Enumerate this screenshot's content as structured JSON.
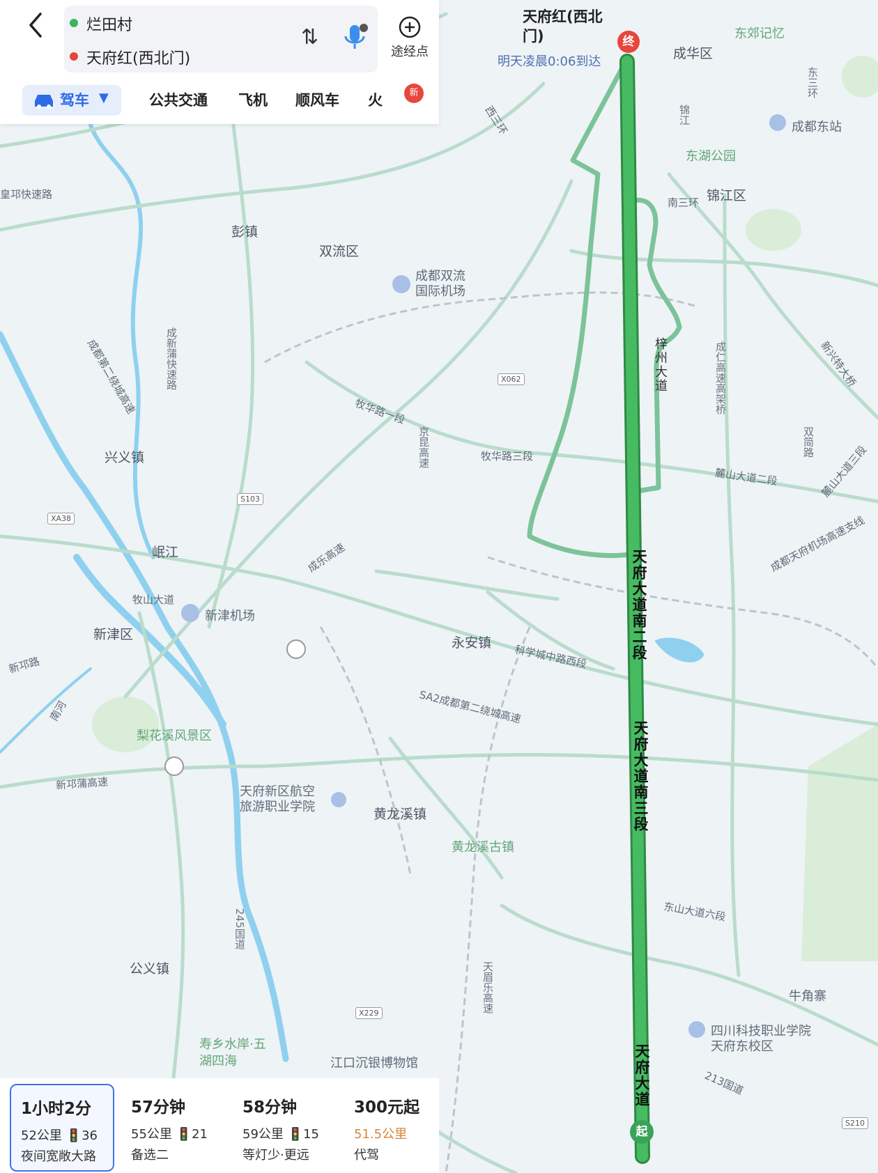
{
  "header": {
    "origin": "烂田村",
    "destination": "天府红(西北门)",
    "via_label": "途经点"
  },
  "mode_tabs": [
    "驾车",
    "公共交通",
    "飞机",
    "顺风车",
    "火"
  ],
  "new_badge": "新",
  "map": {
    "dest_label": "天府红(西北门)",
    "arrival_text": "明天凌晨0:06到达",
    "end_marker": "终",
    "start_marker": "起",
    "place_labels": [
      "成华区",
      "锦江区",
      "双流区",
      "彭镇",
      "兴义镇",
      "新津区",
      "永安镇",
      "黄龙溪镇",
      "公义镇",
      "牛角寨"
    ],
    "poi_labels": [
      "东郊记忆",
      "成都东站",
      "东湖公园",
      "成都双流国际机场",
      "新津机场",
      "梨花溪风景区",
      "天府新区航空旅游职业学院",
      "黄龙溪古镇",
      "寿乡水岸·五湖四海",
      "江口沉银博物馆",
      "四川科技职业学院天府东校区"
    ],
    "road_labels": [
      "西三环",
      "东三环",
      "南三环",
      "锦江",
      "皇邛快速路",
      "成都第二绕城高速",
      "成新蒲快速路",
      "牧华路一段",
      "牧华路三段",
      "麓山大道二段",
      "成都天府机场高速支线",
      "京昆高速",
      "成乐高速",
      "新兴特大桥",
      "岷江",
      "牧山大道",
      "新邛路",
      "南河",
      "新邛蒲高速",
      "科学城中路西段",
      "SA2成都第二绕城高速",
      "东山大道六段",
      "213国道",
      "245国道",
      "天眉乐高速",
      "梓州大道",
      "成仁高速高架桥",
      "双简路",
      "麓山大道三段",
      "天府大道南三段",
      "天府大道南二段",
      "天府大道"
    ],
    "shields": [
      "X062",
      "S103",
      "XA38",
      "X229",
      "S210"
    ]
  },
  "route_options": [
    {
      "time": "1小时2分",
      "distance": "52公里",
      "lights": "36",
      "tag": "夜间宽敞大路",
      "selected": true
    },
    {
      "time": "57分钟",
      "distance": "55公里",
      "lights": "21",
      "tag": "备选二",
      "selected": false
    },
    {
      "time": "58分钟",
      "distance": "59公里",
      "lights": "15",
      "tag": "等灯少·更远",
      "selected": false
    },
    {
      "time": "300元起",
      "distance": "51.5公里",
      "lights": "",
      "tag": "代驾",
      "selected": false
    }
  ],
  "colors": {
    "route": "#3db05a",
    "alt_route": "#7cc39a",
    "accent": "#2e6be6",
    "end": "#e8453c"
  }
}
